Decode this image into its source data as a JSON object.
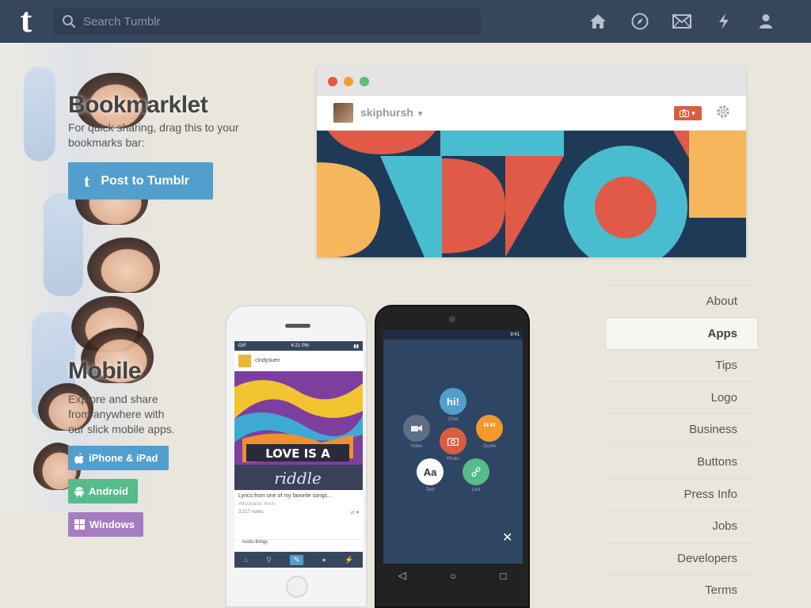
{
  "header": {
    "logo": "t",
    "search_placeholder": "Search Tumblr",
    "icons": [
      "home-icon",
      "explore-icon",
      "inbox-icon",
      "activity-icon",
      "account-icon"
    ]
  },
  "bookmarklet": {
    "title": "Bookmarklet",
    "description_line1": "For quick sharing, drag this to your",
    "description_line2": "bookmarks bar:",
    "button_label": "Post to Tumblr",
    "browser_username": "skiphursh"
  },
  "mobile": {
    "title": "Mobile",
    "description_line1": "Explore and share",
    "description_line2": "from anywhere with",
    "description_line3": "our slick mobile apps.",
    "buttons": {
      "iphone": "iPhone & iPad",
      "android": "Android",
      "windows": "Windows"
    },
    "iphone_screen": {
      "carrier": "GIF",
      "time": "4:21 PM",
      "post_user": "cindysuen",
      "artwork_text1": "LOVE IS A",
      "artwork_text2": "riddle",
      "caption": "Lyrics from one of my favorite songs...",
      "tags": "#illustration  #love",
      "notes": "3,217 notes",
      "next_user": "rustic-things"
    },
    "android_screen": {
      "time": "9:41",
      "bubbles": {
        "chat": "hi!",
        "chat_label": "Chat",
        "video_label": "Video",
        "photo_label": "Photo",
        "quote": "““",
        "quote_label": "Quote",
        "text": "Aa",
        "text_label": "Text",
        "link_label": "Link"
      }
    }
  },
  "sidenav": {
    "items": [
      "About",
      "Apps",
      "Tips",
      "Logo",
      "Business",
      "Buttons",
      "Press Info",
      "Jobs",
      "Developers",
      "Terms"
    ],
    "active": "Apps"
  },
  "colors": {
    "header_bg": "#36465d",
    "tumblr_blue": "#529ecc",
    "iphone_btn": "#529ecc",
    "android_btn": "#56bc8a",
    "windows_btn": "#a77dc2",
    "accent_red": "#d95e40"
  }
}
